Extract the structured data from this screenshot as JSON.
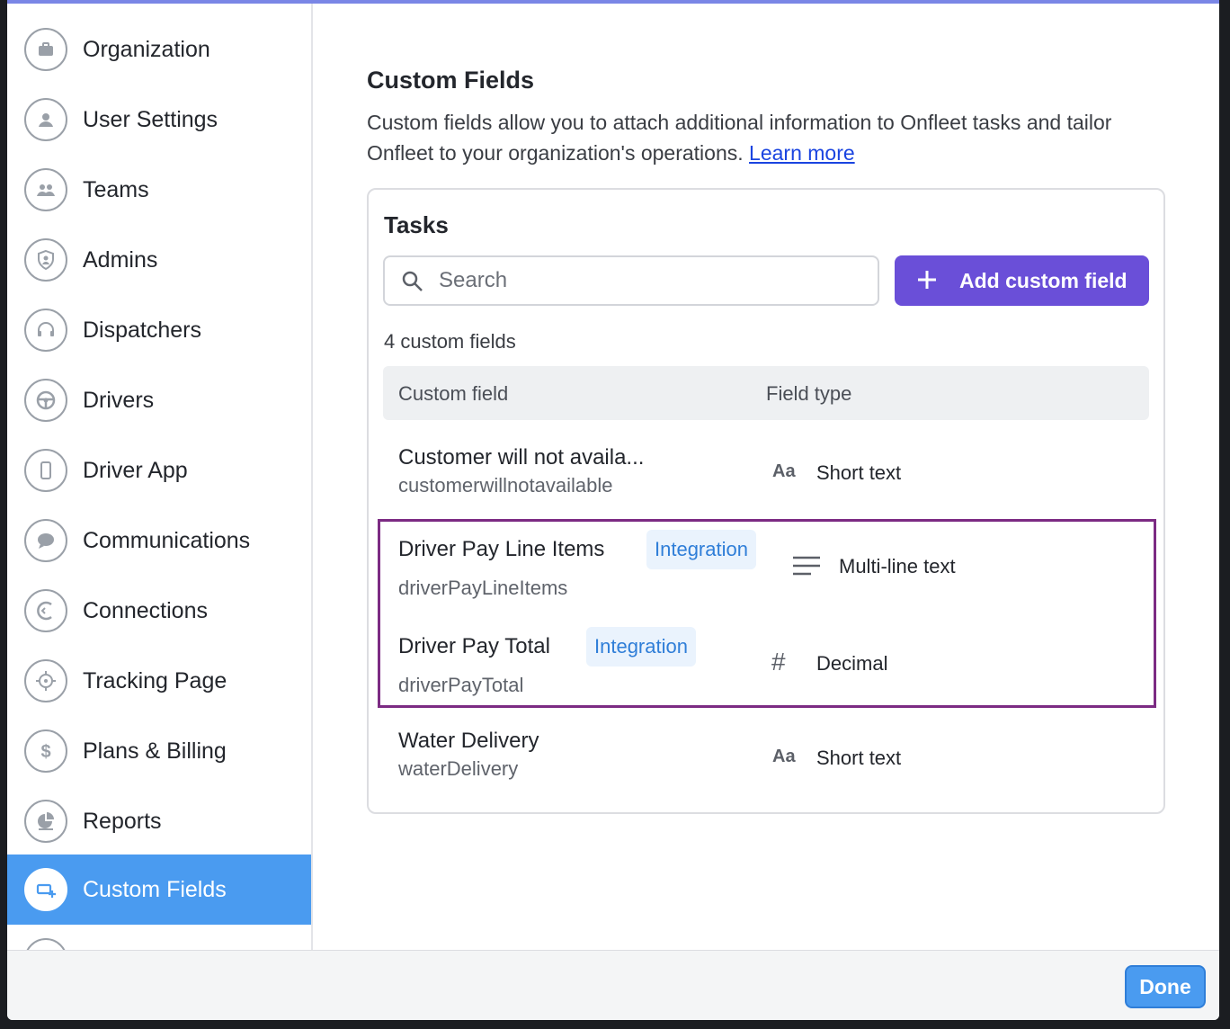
{
  "sidebar": {
    "items": [
      {
        "label": "Organization",
        "icon": "briefcase-icon"
      },
      {
        "label": "User Settings",
        "icon": "user-icon"
      },
      {
        "label": "Teams",
        "icon": "team-icon"
      },
      {
        "label": "Admins",
        "icon": "shield-icon"
      },
      {
        "label": "Dispatchers",
        "icon": "headset-icon"
      },
      {
        "label": "Drivers",
        "icon": "steering-wheel-icon"
      },
      {
        "label": "Driver App",
        "icon": "phone-icon"
      },
      {
        "label": "Communications",
        "icon": "chat-bubble-icon"
      },
      {
        "label": "Connections",
        "icon": "connections-icon"
      },
      {
        "label": "Tracking Page",
        "icon": "crosshair-icon"
      },
      {
        "label": "Plans & Billing",
        "icon": "dollar-icon"
      },
      {
        "label": "Reports",
        "icon": "pie-chart-icon"
      },
      {
        "label": "Custom Fields",
        "icon": "custom-field-icon",
        "active": true
      }
    ]
  },
  "main": {
    "title": "Custom Fields",
    "description": "Custom fields allow you to attach additional information to Onfleet tasks and tailor Onfleet to your organization's operations.",
    "learn_more": "Learn more",
    "card": {
      "title": "Tasks",
      "search_placeholder": "Search",
      "add_button": "Add custom field",
      "count": "4 custom fields",
      "col_field": "Custom field",
      "col_type": "Field type",
      "rows": [
        {
          "name": "Customer will not availa...",
          "key": "customerwillnotavailable",
          "type_icon": "Aa",
          "type": "Short text",
          "badge": ""
        },
        {
          "name": "Driver Pay Line Items",
          "key": "driverPayLineItems",
          "type_icon": "lines",
          "type": "Multi-line text",
          "badge": "Integration"
        },
        {
          "name": "Driver Pay Total",
          "key": "driverPayTotal",
          "type_icon": "#",
          "type": "Decimal",
          "badge": "Integration"
        },
        {
          "name": "Water Delivery",
          "key": "waterDelivery",
          "type_icon": "Aa",
          "type": "Short text",
          "badge": ""
        }
      ]
    }
  },
  "footer": {
    "done": "Done"
  },
  "colors": {
    "accent": "#4a9bf0",
    "primary_button": "#6a4fd8",
    "highlight_border": "#7c2b83",
    "badge_text": "#2f7ed8"
  }
}
